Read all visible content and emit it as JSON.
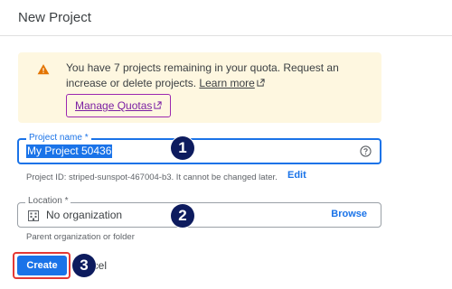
{
  "header": {
    "title": "New Project"
  },
  "quota_banner": {
    "icon": "warning-icon",
    "message": "You have 7 projects remaining in your quota. Request an increase or delete projects.",
    "learn_more": "Learn more",
    "manage_quotas": "Manage Quotas"
  },
  "project_name": {
    "label": "Project name *",
    "value": "My Project 50436",
    "project_id_hint": "Project ID: striped-sunspot-467004-b3. It cannot be changed later.",
    "edit_label": "Edit"
  },
  "location": {
    "label": "Location *",
    "value": "No organization",
    "browse_label": "Browse",
    "hint": "Parent organization or folder"
  },
  "actions": {
    "create_label": "Create",
    "cancel_label": "ncel"
  },
  "step_badges": [
    "1",
    "2",
    "3"
  ],
  "colors": {
    "accent": "#1a73e8",
    "banner_bg": "#fef7e0",
    "warning": "#e37400",
    "manage_quotas": "#7b1fa2",
    "highlight": "#e53935",
    "badge": "#0d1b5e"
  }
}
